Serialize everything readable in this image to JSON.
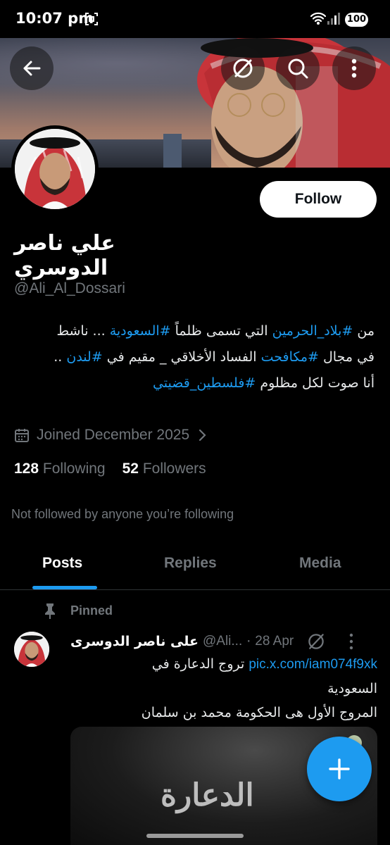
{
  "status_bar": {
    "time": "10:07 pm",
    "battery": "100"
  },
  "header_actions": {
    "back_icon": "arrow-left-icon",
    "grok_icon": "slash-circle-icon",
    "search_icon": "search-icon",
    "more_icon": "more-vertical-icon"
  },
  "profile": {
    "name": "علي ناصر الدوسري",
    "handle": "@Ali_Al_Dossari",
    "follow_label": "Follow",
    "bio_lines": [
      [
        {
          "t": "من ",
          "tag": false
        },
        {
          "t": "#بلاد_الحرمين",
          "tag": true
        },
        {
          "t": " التي تسمى ظلماً ",
          "tag": false
        },
        {
          "t": "#السعودية",
          "tag": true
        },
        {
          "t": " ... ناشط",
          "tag": false
        }
      ],
      [
        {
          "t": "في مجال ",
          "tag": false
        },
        {
          "t": "#مكافحت",
          "tag": true
        },
        {
          "t": " الفساد الأخلاقي _ مقيم في ",
          "tag": false
        },
        {
          "t": "#لندن",
          "tag": true
        },
        {
          "t": " ..",
          "tag": false
        }
      ],
      [
        {
          "t": "أنا صوت لكل مظلوم ",
          "tag": false
        },
        {
          "t": "#فلسطين_قضيتي",
          "tag": true
        }
      ]
    ],
    "joined": "Joined December 2025",
    "following_count": "128",
    "following_label": "Following",
    "followers_count": "52",
    "followers_label": "Followers",
    "not_followed": "Not followed by anyone you’re following"
  },
  "tabs": [
    "Posts",
    "Replies",
    "Media"
  ],
  "active_tab": "Posts",
  "pinned_post": {
    "pinned_label": "Pinned",
    "author_name": "على ناصر الدوسرى",
    "author_handle": "@Ali...",
    "date": "28 Apr",
    "text_lines": [
      [
        {
          "t": "pic.x.com/iam074f9xk",
          "link": true
        },
        {
          "t": " تروج الدعارة في",
          "link": false
        }
      ],
      [
        {
          "t": "السعودية",
          "link": false
        }
      ],
      [
        {
          "t": "المروج الأول هى الحكومة محمد بن سلمان",
          "link": false
        }
      ]
    ],
    "media_title": "الدعارة"
  },
  "colors": {
    "accent": "#1d9bf0",
    "background": "#000000",
    "muted": "#71767b"
  }
}
